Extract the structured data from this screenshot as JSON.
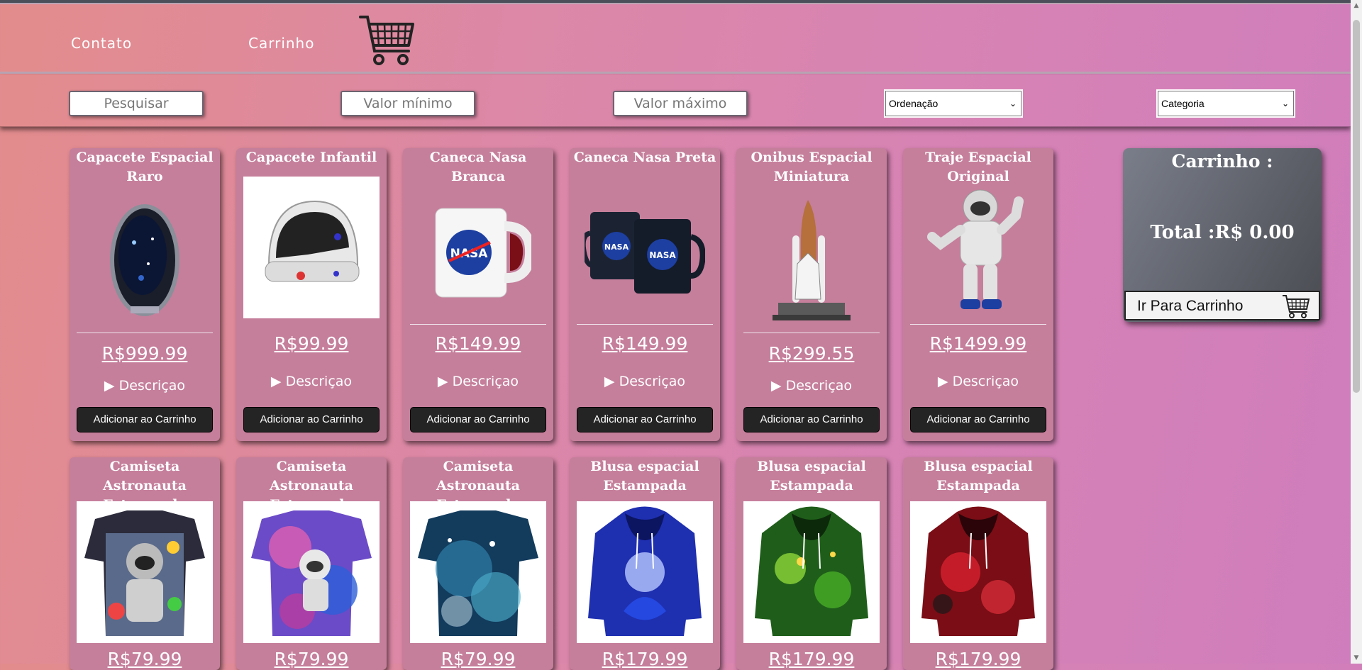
{
  "nav": {
    "contato": "Contato",
    "carrinho": "Carrinho"
  },
  "filters": {
    "search_placeholder": "Pesquisar",
    "min_placeholder": "Valor mínimo",
    "max_placeholder": "Valor máximo",
    "order_selected": "Ordenação",
    "category_selected": "Categoria"
  },
  "products": [
    {
      "title": "Capacete Espacial Raro",
      "price": "R$999.99",
      "desc": "Descriçao",
      "button": "Adicionar ao Carrinho",
      "icon": "helmet-dark"
    },
    {
      "title": "Capacete Infantil",
      "price": "R$99.99",
      "desc": "Descriçao",
      "button": "Adicionar ao Carrinho",
      "icon": "helmet-white"
    },
    {
      "title": "Caneca Nasa Branca",
      "price": "R$149.99",
      "desc": "Descriçao",
      "button": "Adicionar ao Carrinho",
      "icon": "mug-white"
    },
    {
      "title": "Caneca Nasa Preta",
      "price": "R$149.99",
      "desc": "Descriçao",
      "button": "Adicionar ao Carrinho",
      "icon": "mug-black"
    },
    {
      "title": "Onibus Espacial Miniatura",
      "price": "R$299.55",
      "desc": "Descriçao",
      "button": "Adicionar ao Carrinho",
      "icon": "shuttle"
    },
    {
      "title": "Traje Espacial Original",
      "price": "R$1499.99",
      "desc": "Descriçao",
      "button": "Adicionar ao Carrinho",
      "icon": "astronaut"
    },
    {
      "title": "Camiseta Astronauta Estampada",
      "price": "R$79.99",
      "icon": "tshirt-astronaut"
    },
    {
      "title": "Camiseta Astronauta Estampada",
      "price": "R$79.99",
      "icon": "tshirt-galaxy"
    },
    {
      "title": "Camiseta Astronauta Estampada",
      "price": "R$79.99",
      "icon": "tshirt-nebula"
    },
    {
      "title": "Blusa espacial Estampada",
      "price": "R$179.99",
      "icon": "hoodie-blue"
    },
    {
      "title": "Blusa espacial Estampada",
      "price": "R$179.99",
      "icon": "hoodie-green"
    },
    {
      "title": "Blusa espacial Estampada",
      "price": "R$179.99",
      "icon": "hoodie-red"
    }
  ],
  "cart": {
    "title": "Carrinho :",
    "total": "Total :R$ 0.00",
    "button": "Ir Para Carrinho"
  },
  "colors": {
    "card": "#c57f9b",
    "button": "#242424",
    "cart_panel": "#5c5f66"
  }
}
